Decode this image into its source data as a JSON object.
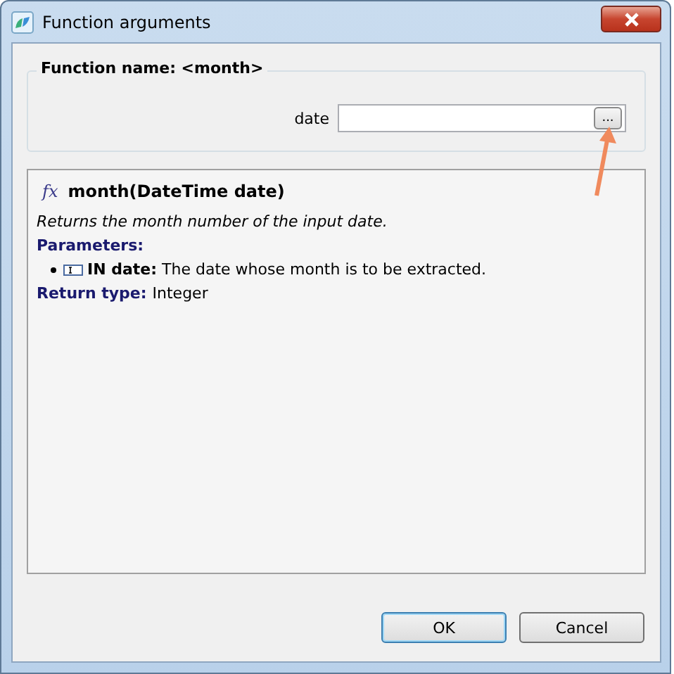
{
  "window": {
    "title": "Function arguments"
  },
  "group": {
    "title": "Function name: <month>",
    "argument": {
      "label": "date",
      "browse_label": "..."
    }
  },
  "description": {
    "function_icon": "fx",
    "signature": "month(DateTime date)",
    "summary": "Returns the month number of the input date.",
    "parameters_label": "Parameters:",
    "parameters": [
      {
        "name": "IN date:",
        "text": "The date whose month is to be extracted."
      }
    ],
    "return_label": "Return type:",
    "return_type": "Integer"
  },
  "buttons": [
    {
      "label": "OK",
      "default": true
    },
    {
      "label": "Cancel",
      "default": false
    }
  ]
}
